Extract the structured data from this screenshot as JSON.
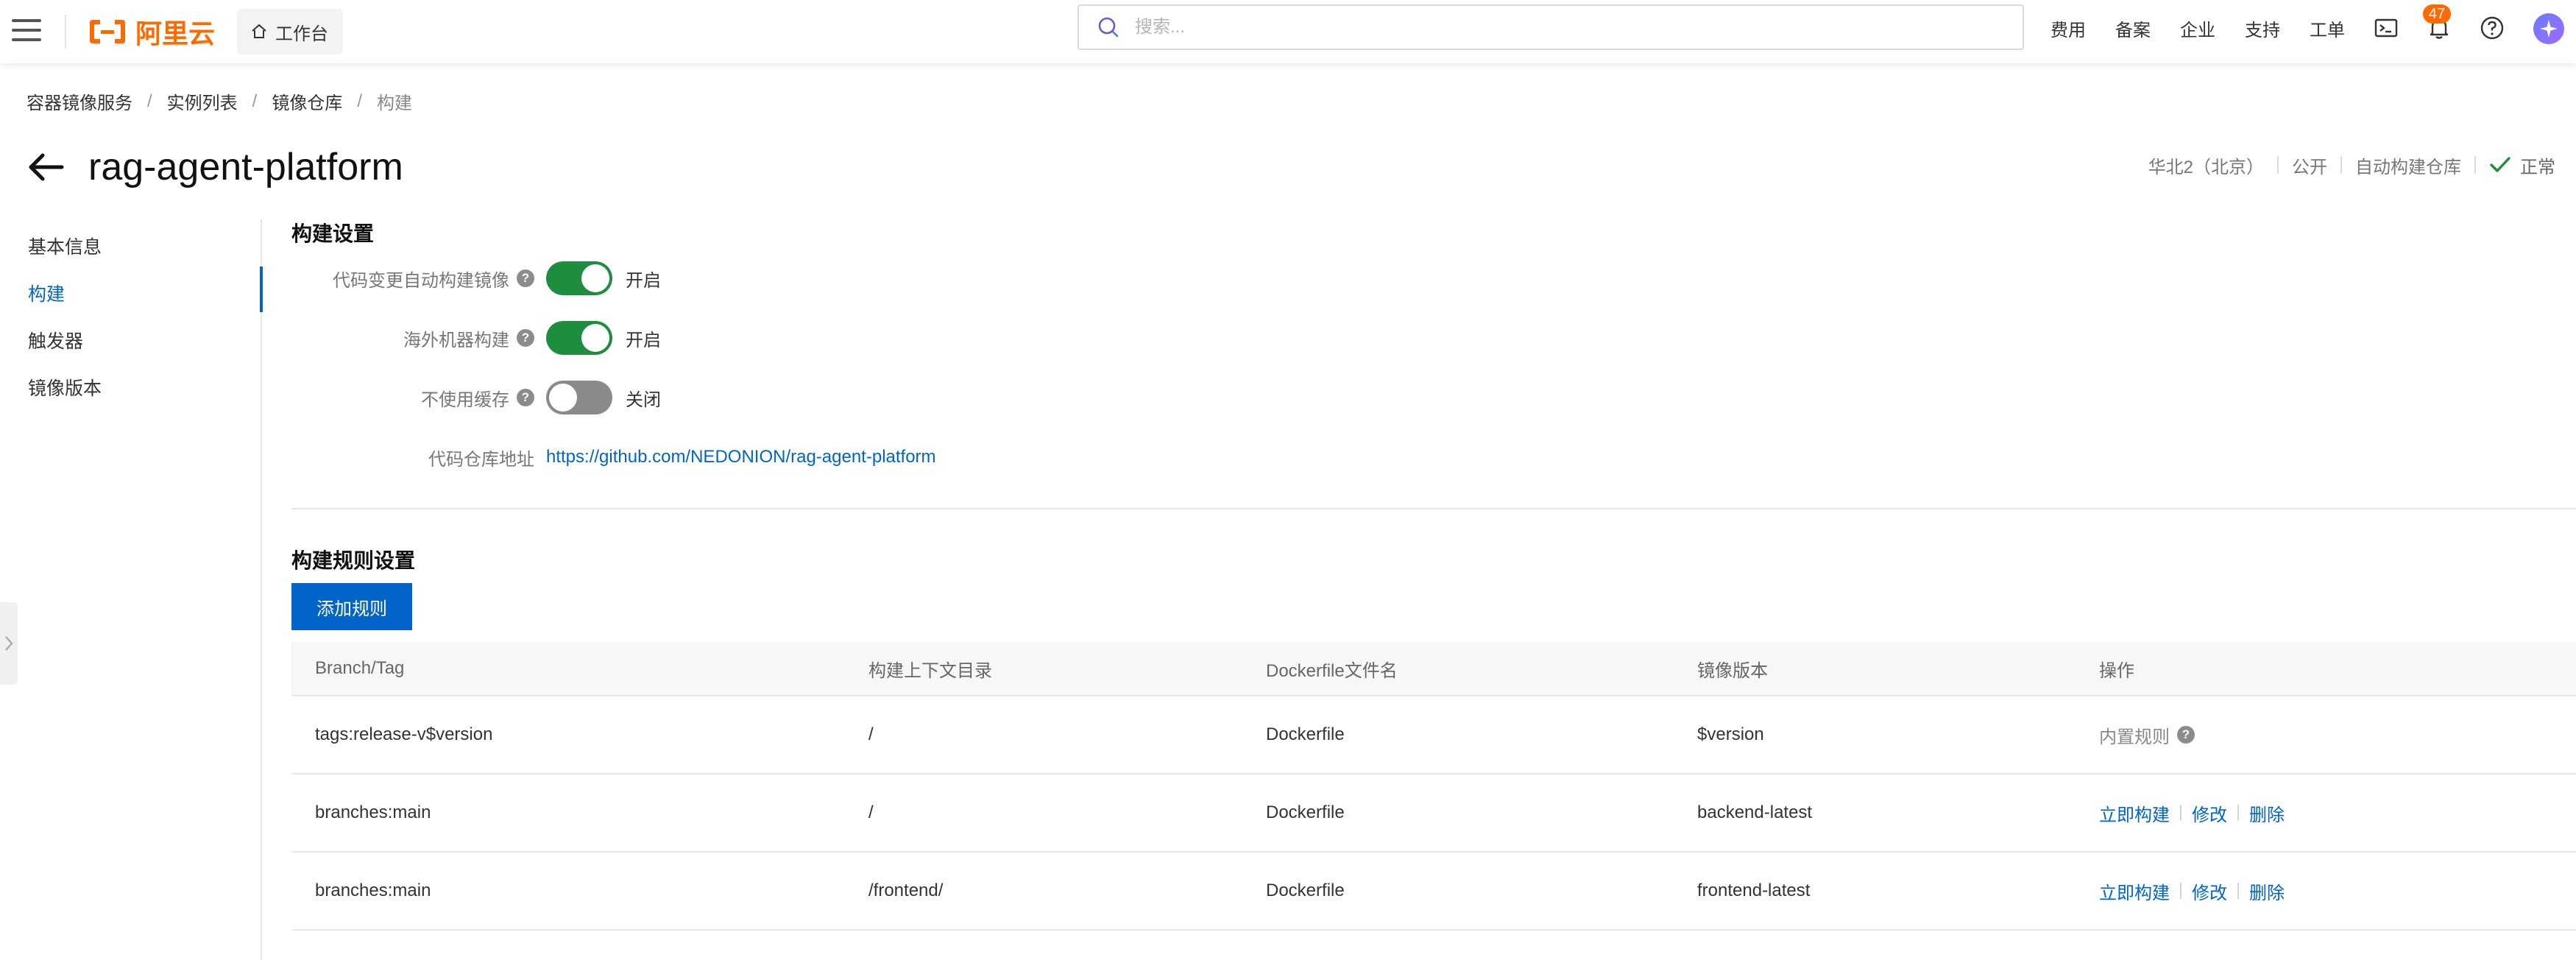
{
  "topbar": {
    "logo_text": "阿里云",
    "workbench_label": "工作台",
    "search_placeholder": "搜索...",
    "nav": [
      "费用",
      "备案",
      "企业",
      "支持",
      "工单"
    ],
    "notification_count": "47",
    "accent_color": "#ff6a00"
  },
  "breadcrumb": [
    "容器镜像服务",
    "实例列表",
    "镜像仓库",
    "构建"
  ],
  "page": {
    "title": "rag-agent-platform",
    "meta": {
      "region": "华北2（北京）",
      "visibility": "公开",
      "repo_type": "自动构建仓库",
      "status": "正常",
      "status_color": "#1e8e3e"
    }
  },
  "sidenav": {
    "items": [
      "基本信息",
      "构建",
      "触发器",
      "镜像版本"
    ],
    "active_index": 1
  },
  "build_settings": {
    "title": "构建设置",
    "rows": [
      {
        "label": "代码变更自动构建镜像",
        "state": "on",
        "state_text": "开启"
      },
      {
        "label": "海外机器构建",
        "state": "on",
        "state_text": "开启"
      },
      {
        "label": "不使用缓存",
        "state": "off",
        "state_text": "关闭"
      }
    ],
    "repo_label": "代码仓库地址",
    "repo_url": "https://github.com/NEDONION/rag-agent-platform"
  },
  "build_rules": {
    "title": "构建规则设置",
    "add_button": "添加规则",
    "columns": [
      "Branch/Tag",
      "构建上下文目录",
      "Dockerfile文件名",
      "镜像版本",
      "操作"
    ],
    "rows": [
      {
        "branch": "tags:release-v$version",
        "context": "/",
        "dockerfile": "Dockerfile",
        "version": "$version",
        "builtin": "内置规则"
      },
      {
        "branch": "branches:main",
        "context": "/",
        "dockerfile": "Dockerfile",
        "version": "backend-latest",
        "actions": [
          "立即构建",
          "修改",
          "删除"
        ]
      },
      {
        "branch": "branches:main",
        "context": "/frontend/",
        "dockerfile": "Dockerfile",
        "version": "frontend-latest",
        "actions": [
          "立即构建",
          "修改",
          "删除"
        ]
      }
    ]
  }
}
